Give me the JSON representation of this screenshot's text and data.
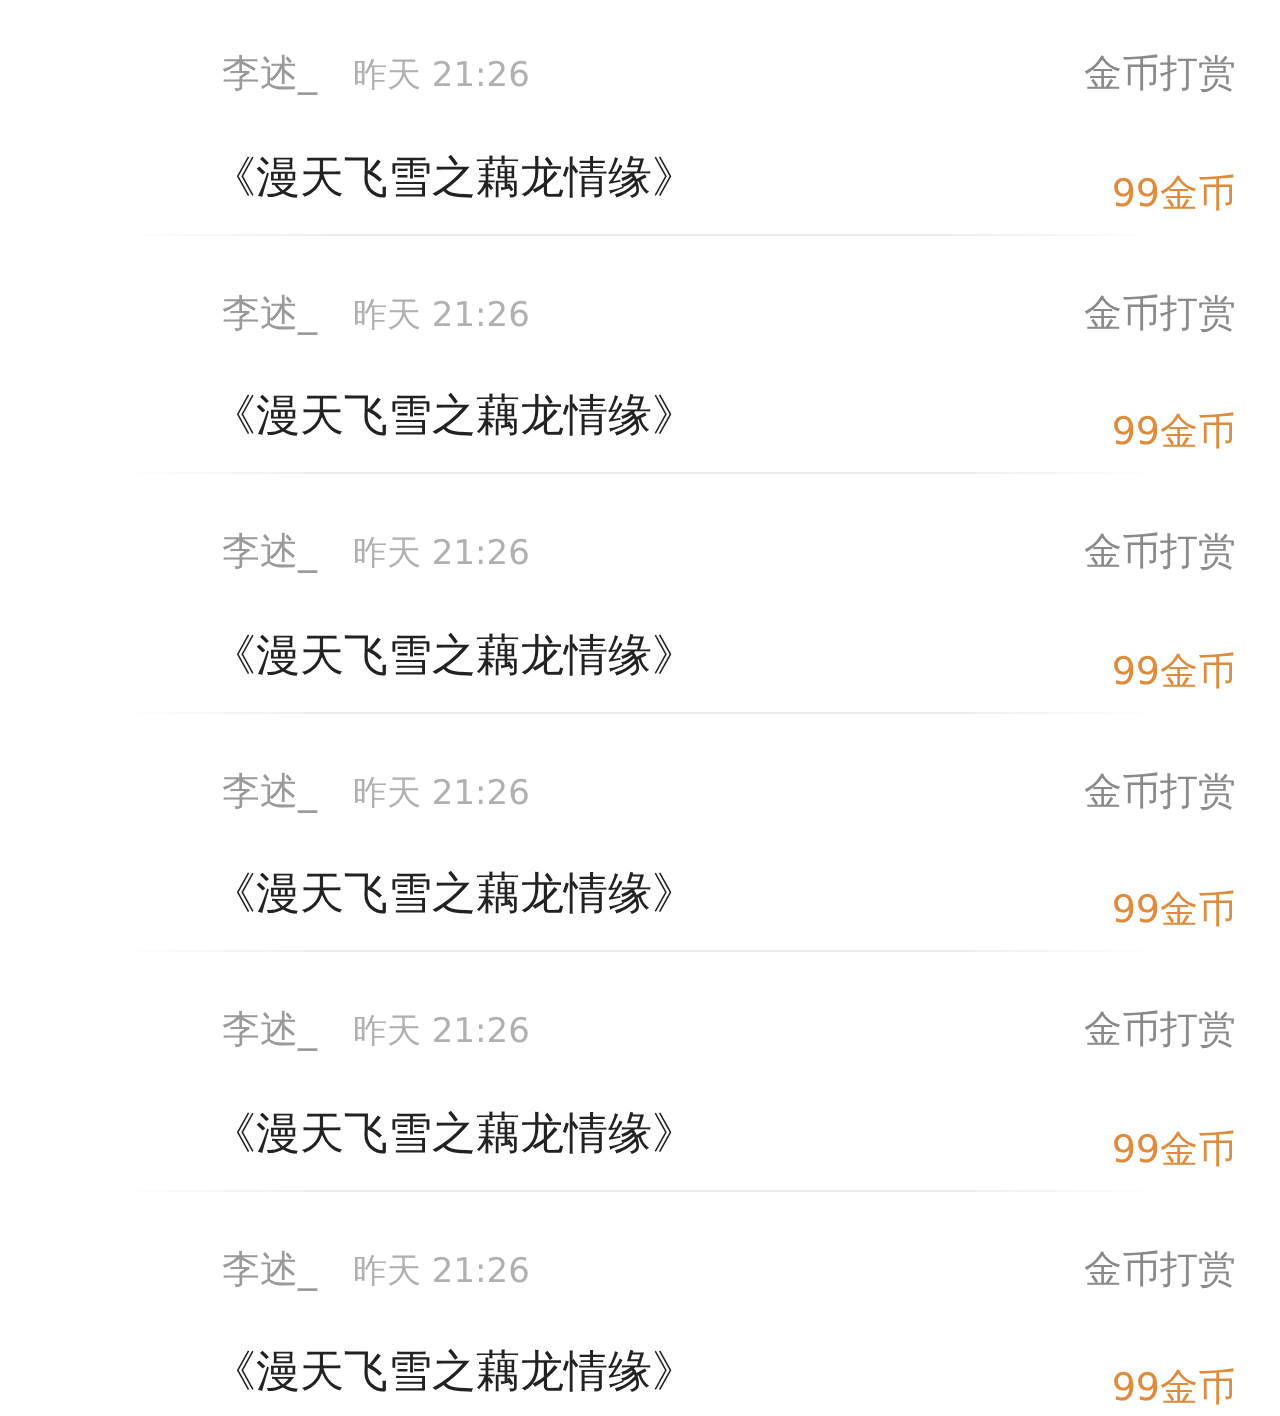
{
  "records": [
    {
      "user": "李述_",
      "time": "昨天 21:26",
      "title": "《漫天飞雪之藕龙情缘》",
      "type": "金币打赏",
      "amount": "99金币"
    },
    {
      "user": "李述_",
      "time": "昨天 21:26",
      "title": "《漫天飞雪之藕龙情缘》",
      "type": "金币打赏",
      "amount": "99金币"
    },
    {
      "user": "李述_",
      "time": "昨天 21:26",
      "title": "《漫天飞雪之藕龙情缘》",
      "type": "金币打赏",
      "amount": "99金币"
    },
    {
      "user": "李述_",
      "time": "昨天 21:26",
      "title": "《漫天飞雪之藕龙情缘》",
      "type": "金币打赏",
      "amount": "99金币"
    },
    {
      "user": "李述_",
      "time": "昨天 21:26",
      "title": "《漫天飞雪之藕龙情缘》",
      "type": "金币打赏",
      "amount": "99金币"
    },
    {
      "user": "李述_",
      "time": "昨天 21:26",
      "title": "《漫天飞雪之藕龙情缘》",
      "type": "金币打赏",
      "amount": "99金币"
    }
  ]
}
